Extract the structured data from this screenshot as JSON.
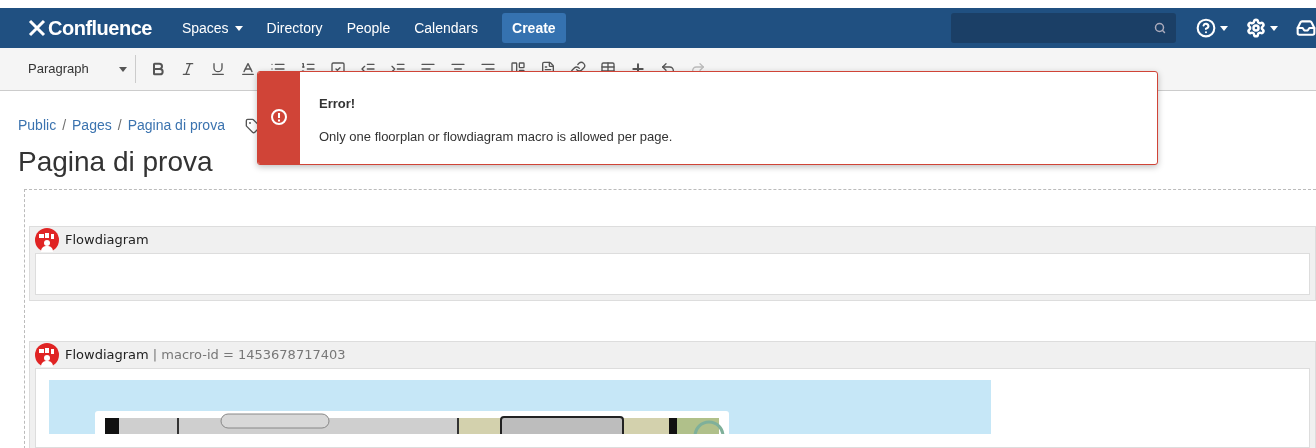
{
  "nav": {
    "logo": "Confluence",
    "items": [
      {
        "label": "Spaces",
        "dropdown": true
      },
      {
        "label": "Directory",
        "dropdown": false
      },
      {
        "label": "People",
        "dropdown": false
      },
      {
        "label": "Calendars",
        "dropdown": false
      }
    ],
    "create": "Create"
  },
  "toolbar": {
    "format": "Paragraph"
  },
  "breadcrumbs": {
    "separator": "/",
    "items": [
      "Public",
      "Pages",
      "Pagina di prova"
    ]
  },
  "page_title": "Pagina di prova",
  "error": {
    "title": "Error!",
    "message": "Only one floorplan or flowdiagram macro is allowed per page."
  },
  "macros": [
    {
      "name": "Flowdiagram",
      "kind": "empty"
    },
    {
      "name": "Flowdiagram",
      "meta": "| macro-id = 1453678717403",
      "kind": "picture"
    }
  ]
}
